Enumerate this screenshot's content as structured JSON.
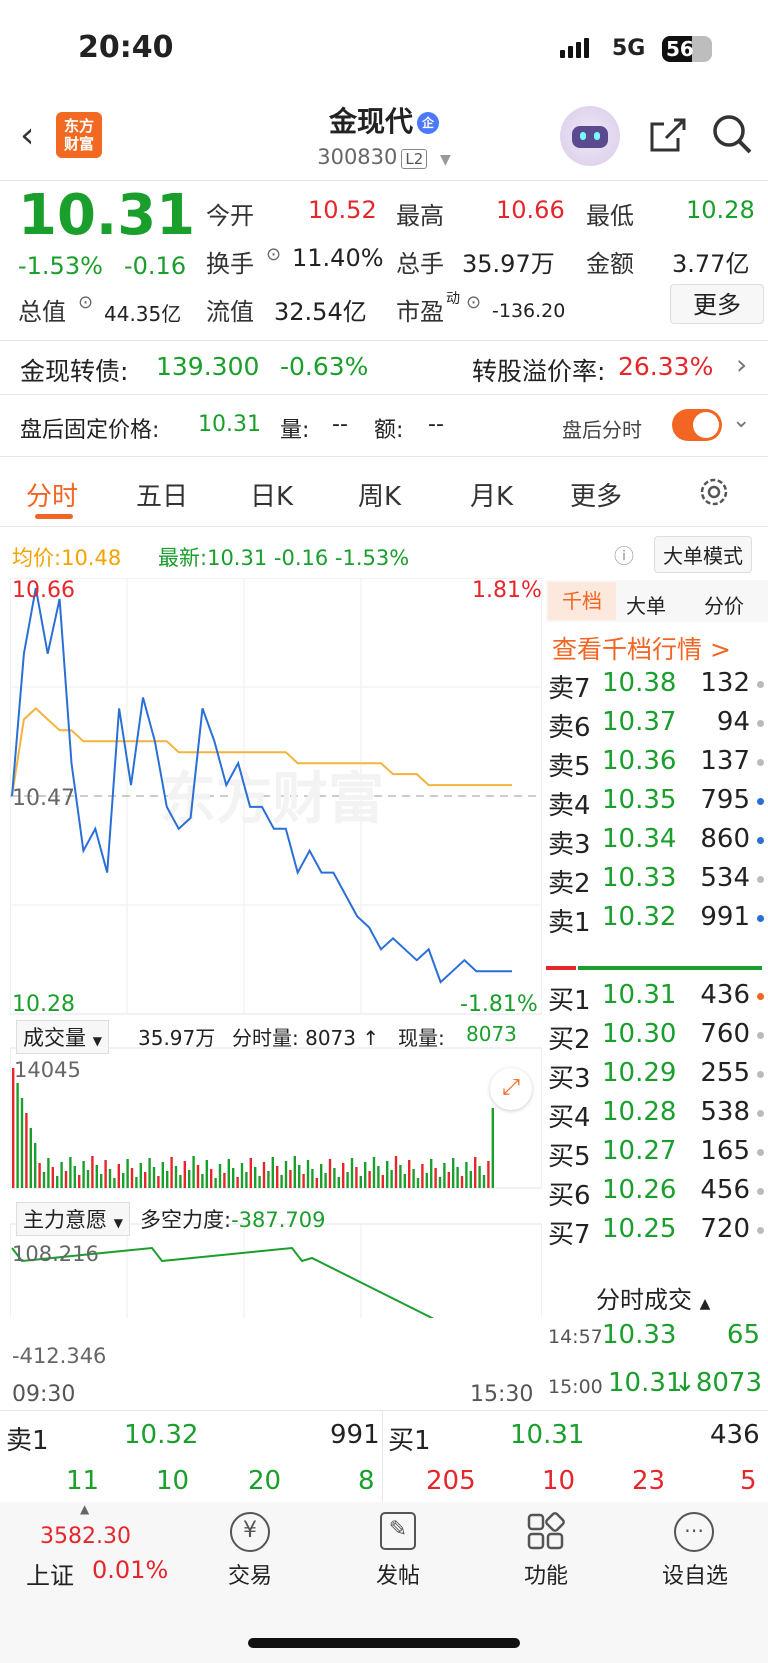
{
  "status": {
    "time": "20:40",
    "network": "5G",
    "battery": "56"
  },
  "header": {
    "logo_line1": "东方",
    "logo_line2": "财富",
    "name": "金现代",
    "ent_badge": "企",
    "code": "300830",
    "level": "L2"
  },
  "quote": {
    "price": "10.31",
    "change_pct": "-1.53%",
    "change": "-0.16",
    "open_label": "今开",
    "open": "10.52",
    "high_label": "最高",
    "high": "10.66",
    "low_label": "最低",
    "low": "10.28",
    "turnover_label": "换手",
    "turnover": "11.40%",
    "volume_label": "总手",
    "volume": "35.97万",
    "amount_label": "金额",
    "amount": "3.77亿",
    "mcap_label": "总值",
    "mcap": "44.35亿",
    "float_label": "流值",
    "float": "32.54亿",
    "pe_label": "市盈",
    "pe_sup": "动",
    "pe": "-136.20",
    "more": "更多"
  },
  "bond": {
    "label": "金现转债:",
    "price": "139.300",
    "pct": "-0.63%",
    "premium_label": "转股溢价率:",
    "premium": "26.33%"
  },
  "afterhours": {
    "label": "盘后固定价格:",
    "price": "10.31",
    "vol_label": "量:",
    "vol": "--",
    "amt_label": "额:",
    "amt": "--",
    "switch_label": "盘后分时"
  },
  "tabs": [
    "分时",
    "五日",
    "日K",
    "周K",
    "月K",
    "更多"
  ],
  "legend": {
    "avg_label": "均价:",
    "avg": "10.48",
    "last_label": "最新:",
    "last": "10.31",
    "chg": "-0.16",
    "pct": "-1.53%",
    "bigorder": "大单模式"
  },
  "chart_labels": {
    "high": "10.66",
    "high_pct": "1.81%",
    "mid": "10.47",
    "low": "10.28",
    "low_pct": "-1.81%",
    "vol_selector": "成交量",
    "vol_total": "35.97万",
    "vol_period": "分时量: 8073 ↑",
    "vol_now_label": "现量:",
    "vol_now": "8073",
    "vol_max": "14045",
    "ind_selector": "主力意愿",
    "ind_label": "多空力度:",
    "ind_value": "-387.709",
    "ind_high": "108.216",
    "ind_low": "-412.346",
    "t_start": "09:30",
    "t_end": "15:30"
  },
  "chart_data": {
    "type": "line",
    "x_range": [
      "09:30",
      "15:00"
    ],
    "ylim": [
      10.28,
      10.66
    ],
    "series": [
      {
        "name": "最新",
        "values": [
          10.47,
          10.6,
          10.66,
          10.6,
          10.65,
          10.5,
          10.42,
          10.44,
          10.4,
          10.55,
          10.48,
          10.56,
          10.52,
          10.46,
          10.44,
          10.45,
          10.55,
          10.52,
          10.48,
          10.5,
          10.46,
          10.46,
          10.44,
          10.44,
          10.4,
          10.42,
          10.4,
          10.4,
          10.38,
          10.36,
          10.35,
          10.33,
          10.34,
          10.33,
          10.32,
          10.33,
          10.3,
          10.31,
          10.32,
          10.31,
          10.31,
          10.31,
          10.31
        ]
      },
      {
        "name": "均价",
        "values": [
          10.47,
          10.54,
          10.55,
          10.54,
          10.53,
          10.53,
          10.52,
          10.52,
          10.52,
          10.52,
          10.52,
          10.52,
          10.52,
          10.52,
          10.51,
          10.51,
          10.51,
          10.51,
          10.51,
          10.51,
          10.51,
          10.51,
          10.51,
          10.51,
          10.5,
          10.5,
          10.5,
          10.5,
          10.5,
          10.5,
          10.5,
          10.5,
          10.49,
          10.49,
          10.49,
          10.48,
          10.48,
          10.48,
          10.48,
          10.48,
          10.48,
          10.48,
          10.48
        ]
      }
    ]
  },
  "orderbook": {
    "tabs": [
      "千档",
      "大单",
      "分价"
    ],
    "link": "查看千档行情 >",
    "asks": [
      {
        "label": "卖7",
        "price": "10.38",
        "vol": "132",
        "dot": "#bbbbbb"
      },
      {
        "label": "卖6",
        "price": "10.37",
        "vol": "94",
        "dot": "#bbbbbb"
      },
      {
        "label": "卖5",
        "price": "10.36",
        "vol": "137",
        "dot": "#bbbbbb"
      },
      {
        "label": "卖4",
        "price": "10.35",
        "vol": "795",
        "dot": "#2a6fd6"
      },
      {
        "label": "卖3",
        "price": "10.34",
        "vol": "860",
        "dot": "#2a6fd6"
      },
      {
        "label": "卖2",
        "price": "10.33",
        "vol": "534",
        "dot": "#bbbbbb"
      },
      {
        "label": "卖1",
        "price": "10.32",
        "vol": "991",
        "dot": "#2a6fd6"
      }
    ],
    "bids": [
      {
        "label": "买1",
        "price": "10.31",
        "vol": "436",
        "dot": "#f26522"
      },
      {
        "label": "买2",
        "price": "10.30",
        "vol": "760",
        "dot": "#bbbbbb"
      },
      {
        "label": "买3",
        "price": "10.29",
        "vol": "255",
        "dot": "#bbbbbb"
      },
      {
        "label": "买4",
        "price": "10.28",
        "vol": "538",
        "dot": "#bbbbbb"
      },
      {
        "label": "买5",
        "price": "10.27",
        "vol": "165",
        "dot": "#bbbbbb"
      },
      {
        "label": "买6",
        "price": "10.26",
        "vol": "456",
        "dot": "#bbbbbb"
      },
      {
        "label": "买7",
        "price": "10.25",
        "vol": "720",
        "dot": "#bbbbbb"
      }
    ],
    "ticks_title": "分时成交",
    "ticks": [
      {
        "time": "14:57",
        "price": "10.33",
        "vol": "65"
      },
      {
        "time": "15:00",
        "price": "10.31",
        "vol": "8073"
      }
    ]
  },
  "summary": {
    "sell_label": "卖1",
    "sell_price": "10.32",
    "sell_vol": "991",
    "buy_label": "买1",
    "buy_price": "10.31",
    "buy_vol": "436",
    "sell_queue": [
      "11",
      "10",
      "20",
      "8"
    ],
    "buy_queue": [
      "205",
      "10",
      "23",
      "5"
    ]
  },
  "nav": {
    "index_value": "3582.30",
    "index_name": "上证",
    "index_pct": "0.01%",
    "items": [
      "交易",
      "发帖",
      "功能",
      "设自选"
    ]
  },
  "colors": {
    "accent": "#f26522",
    "up": "#e5262b",
    "down": "#1a9e2c",
    "line": "#2a6fd6",
    "avg": "#f4b33c"
  }
}
